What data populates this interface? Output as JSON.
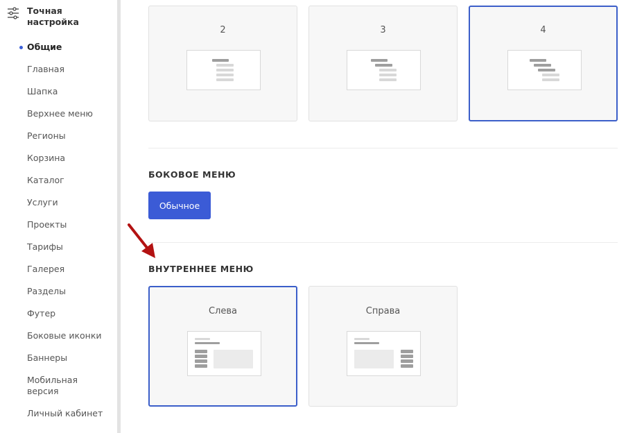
{
  "sidebar": {
    "title": "Точная настройка",
    "items": [
      {
        "label": "Общие",
        "active": true
      },
      {
        "label": "Главная"
      },
      {
        "label": "Шапка"
      },
      {
        "label": "Верхнее меню"
      },
      {
        "label": "Регионы"
      },
      {
        "label": "Корзина"
      },
      {
        "label": "Каталог"
      },
      {
        "label": "Услуги"
      },
      {
        "label": "Проекты"
      },
      {
        "label": "Тарифы"
      },
      {
        "label": "Галерея"
      },
      {
        "label": "Разделы"
      },
      {
        "label": "Футер"
      },
      {
        "label": "Боковые иконки"
      },
      {
        "label": "Баннеры"
      },
      {
        "label": "Мобильная версия"
      },
      {
        "label": "Личный кабинет"
      }
    ]
  },
  "top_options": [
    {
      "label": "2",
      "selected": false
    },
    {
      "label": "3",
      "selected": false
    },
    {
      "label": "4",
      "selected": true
    }
  ],
  "side_menu": {
    "title": "БОКОВОЕ МЕНЮ",
    "button_label": "Обычное"
  },
  "inner_menu": {
    "title": "ВНУТРЕННЕЕ МЕНЮ",
    "options": [
      {
        "label": "Слева",
        "selected": true
      },
      {
        "label": "Справа",
        "selected": false
      }
    ]
  },
  "colors": {
    "accent": "#3b5bd6",
    "selected_border": "#3b5ec9",
    "arrow": "#b31212"
  }
}
